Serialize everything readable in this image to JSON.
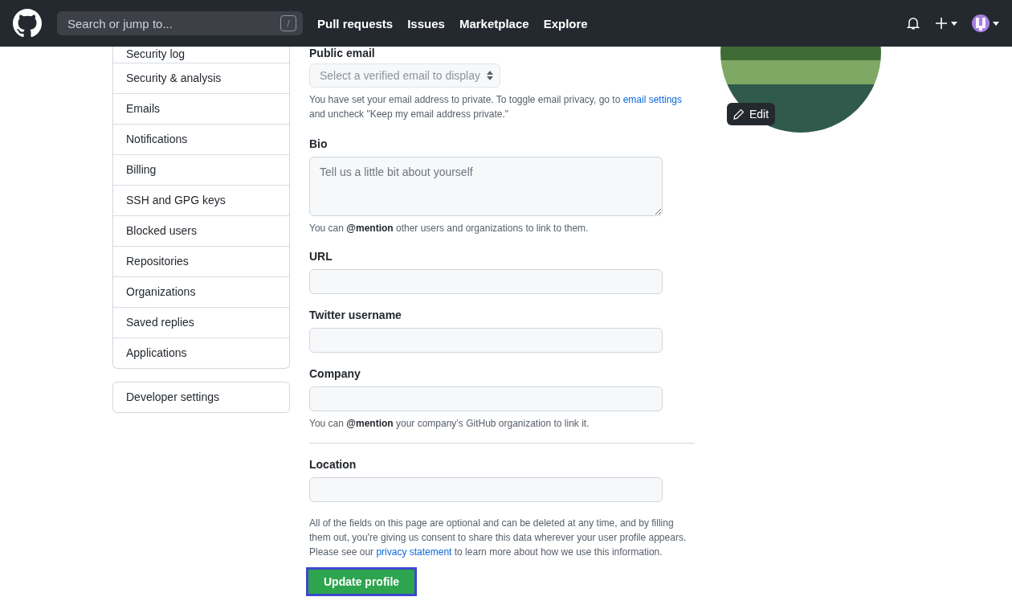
{
  "header": {
    "search_placeholder": "Search or jump to...",
    "search_key": "/",
    "nav": [
      "Pull requests",
      "Issues",
      "Marketplace",
      "Explore"
    ]
  },
  "sidebar": {
    "items": [
      "Security log",
      "Security & analysis",
      "Emails",
      "Notifications",
      "Billing",
      "SSH and GPG keys",
      "Blocked users",
      "Repositories",
      "Organizations",
      "Saved replies",
      "Applications"
    ],
    "developer_item": "Developer settings"
  },
  "public_email": {
    "label": "Public email",
    "select_placeholder": "Select a verified email to display",
    "note_before": "You have set your email address to private. To toggle email privacy, go to ",
    "note_link": "email settings",
    "note_after": " and uncheck \"Keep my email address private.\""
  },
  "fields": [
    {
      "kind": "textarea",
      "label": "Bio",
      "placeholder": "Tell us a little bit about yourself",
      "note": "You can **@mention** other users and organizations to link to them."
    },
    {
      "kind": "input",
      "label": "URL"
    },
    {
      "kind": "input",
      "label": "Twitter username"
    },
    {
      "kind": "input",
      "label": "Company",
      "note": "You can **@mention** your company’s GitHub organization to link it."
    },
    {
      "kind": "divider"
    },
    {
      "kind": "input",
      "label": "Location"
    }
  ],
  "disclaimer": {
    "before": "All of the fields on this page are optional and can be deleted at any time, and by filling them out, you're giving us consent to share this data wherever your user profile appears. Please see our ",
    "link": "privacy statement",
    "after": " to learn more about how we use this information."
  },
  "submit": {
    "label": "Update profile",
    "focused": true
  },
  "avatar": {
    "edit_label": "Edit"
  }
}
